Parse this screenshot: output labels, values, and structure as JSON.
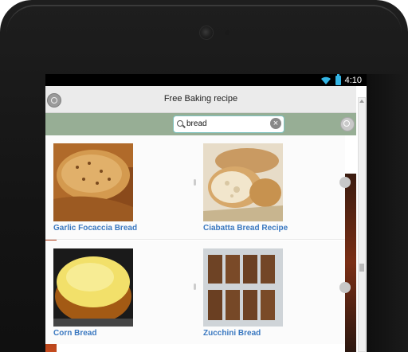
{
  "status": {
    "time": "4:10"
  },
  "header": {
    "title": "Free Baking recipe"
  },
  "search": {
    "query": "bread"
  },
  "recipes": [
    {
      "name": "Garlic Focaccia Bread"
    },
    {
      "name": "Ciabatta Bread Recipe"
    },
    {
      "name": "Corn Bread"
    },
    {
      "name": "Zucchini Bread"
    }
  ],
  "colors": {
    "search_bar": "#97ae95",
    "link": "#3a78c0",
    "accent": "#33b5e5"
  }
}
